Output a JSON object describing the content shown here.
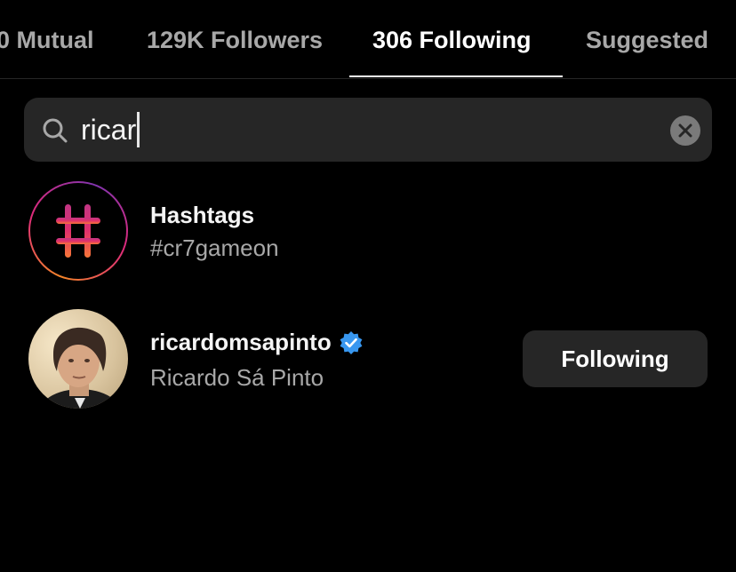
{
  "tabs": [
    {
      "label": "0 Mutual",
      "active": false
    },
    {
      "label": "129K Followers",
      "active": false
    },
    {
      "label": "306 Following",
      "active": true
    },
    {
      "label": "Suggested",
      "active": false
    }
  ],
  "search": {
    "value": "ricar",
    "icons": {
      "search": "search-icon",
      "clear": "clear-x-icon"
    }
  },
  "results": [
    {
      "type": "hashtag",
      "title": "Hashtags",
      "subtitle": "#cr7gameon",
      "icon": "hashtag-icon"
    },
    {
      "type": "user",
      "username": "ricardomsapinto",
      "full_name": "Ricardo Sá Pinto",
      "verified": true,
      "button_label": "Following"
    }
  ],
  "colors": {
    "background": "#000000",
    "muted_text": "#a8a8a8",
    "surface": "#262626",
    "verified": "#3897f0"
  }
}
